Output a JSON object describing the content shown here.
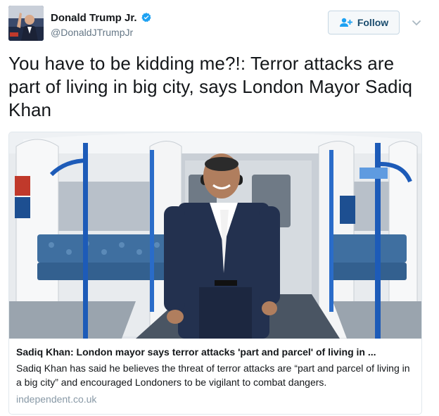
{
  "author": {
    "display_name": "Donald Trump Jr.",
    "handle": "@DonaldJTrumpJr",
    "verified_icon": "verified-badge-icon"
  },
  "follow_button": {
    "label": "Follow",
    "icon": "add-user-icon"
  },
  "menu_caret": {
    "icon": "chevron-down-icon"
  },
  "tweet_text": "You have to be kidding me?!: Terror attacks are part of living in big city, says London Mayor Sadiq Khan",
  "card": {
    "title": "Sadiq Khan: London mayor says terror attacks 'part and parcel' of living in ...",
    "description": "Sadiq Khan has said he believes the threat of terror attacks are “part and parcel of living in a big city” and encouraged Londoners to be vigilant to combat dangers.",
    "domain": "independent.co.uk"
  },
  "colors": {
    "link_blue": "#1da1f2",
    "text": "#14171a",
    "secondary": "#657786",
    "border": "#e1e8ed"
  }
}
